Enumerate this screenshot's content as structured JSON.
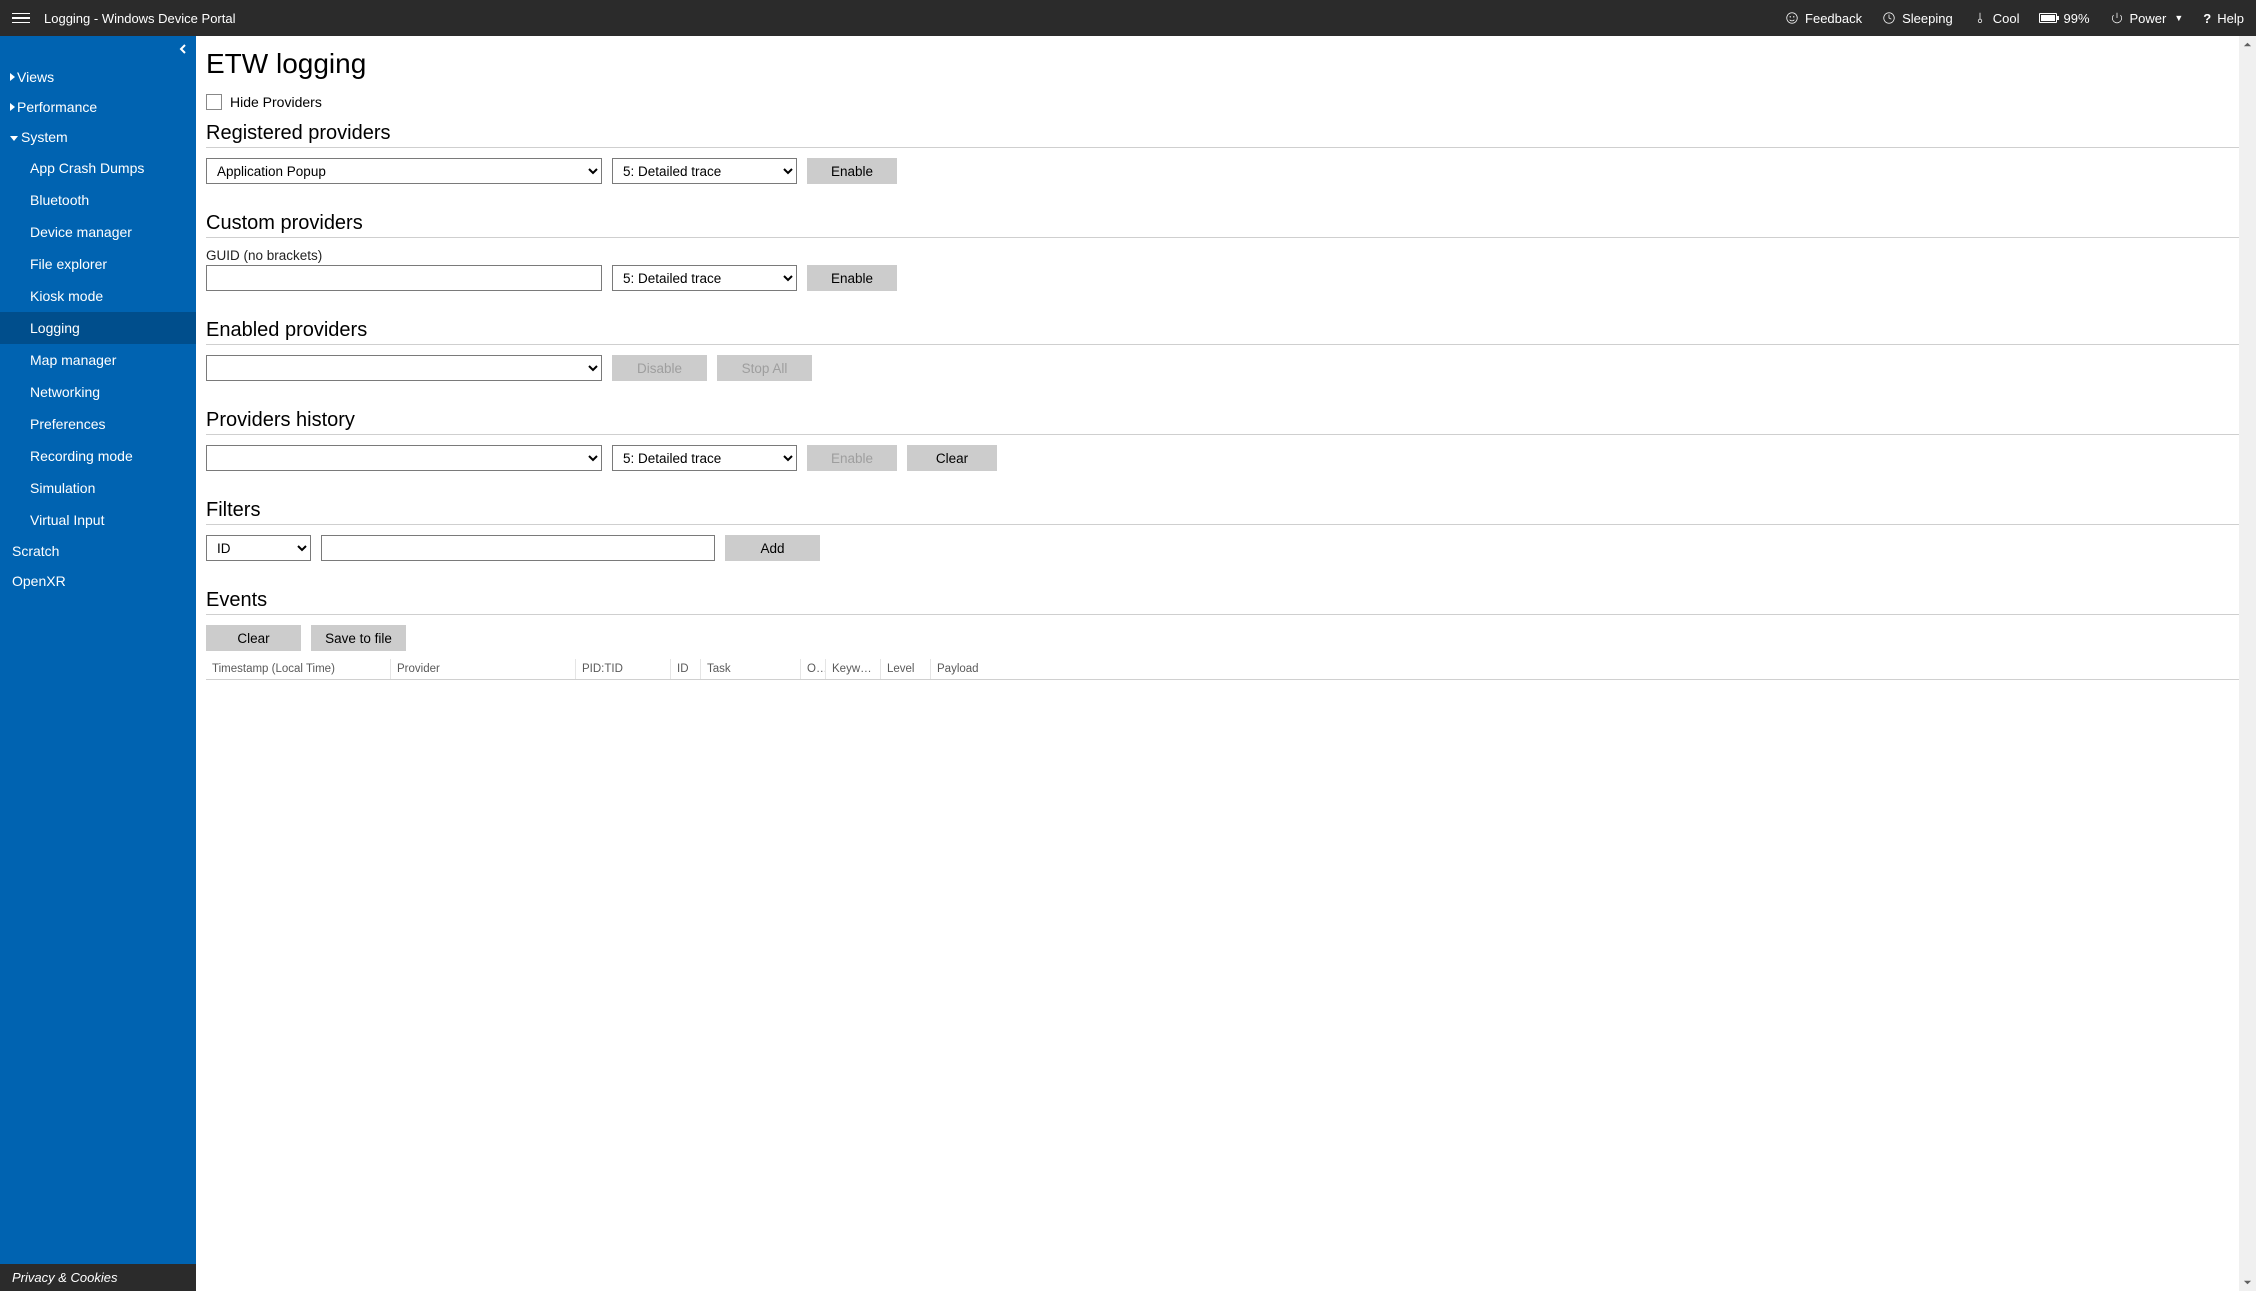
{
  "header": {
    "title": "Logging - Windows Device Portal",
    "feedback": "Feedback",
    "sleep": "Sleeping",
    "temp": "Cool",
    "battery": "99%",
    "power": "Power",
    "help": "Help"
  },
  "sidebar": {
    "items": [
      {
        "label": "Views",
        "expanded": false
      },
      {
        "label": "Performance",
        "expanded": false
      },
      {
        "label": "System",
        "expanded": true
      }
    ],
    "system_children": [
      "App Crash Dumps",
      "Bluetooth",
      "Device manager",
      "File explorer",
      "Kiosk mode",
      "Logging",
      "Map manager",
      "Networking",
      "Preferences",
      "Recording mode",
      "Simulation",
      "Virtual Input"
    ],
    "active_child": "Logging",
    "extra_top": [
      "Scratch",
      "OpenXR"
    ],
    "footer": "Privacy & Cookies"
  },
  "page": {
    "title": "ETW logging",
    "hide_providers": "Hide Providers",
    "sections": {
      "registered": {
        "title": "Registered providers",
        "provider_selected": "Application Popup",
        "level_selected": "5: Detailed trace",
        "enable": "Enable"
      },
      "custom": {
        "title": "Custom providers",
        "guid_label": "GUID (no brackets)",
        "guid_value": "",
        "level_selected": "5: Detailed trace",
        "enable": "Enable"
      },
      "enabled": {
        "title": "Enabled providers",
        "selected": "",
        "disable": "Disable",
        "stop_all": "Stop All"
      },
      "history": {
        "title": "Providers history",
        "selected": "",
        "level_selected": "5: Detailed trace",
        "enable": "Enable",
        "clear": "Clear"
      },
      "filters": {
        "title": "Filters",
        "field_selected": "ID",
        "value": "",
        "add": "Add"
      },
      "events": {
        "title": "Events",
        "clear": "Clear",
        "save": "Save to file",
        "columns": [
          "Timestamp (Local Time)",
          "Provider",
          "PID:TID",
          "ID",
          "Task",
          "O...",
          "Keyword",
          "Level",
          "Payload"
        ]
      }
    }
  }
}
